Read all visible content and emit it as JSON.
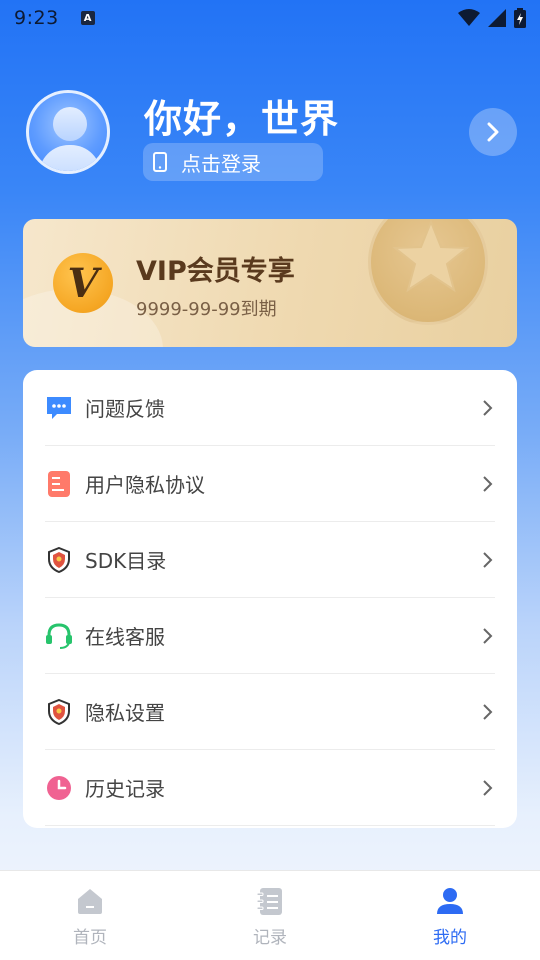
{
  "status_bar": {
    "time": "9:23",
    "notification_letter": "A"
  },
  "profile": {
    "greeting": "你好，世界",
    "login_label": "点击登录"
  },
  "vip": {
    "badge_letter": "V",
    "title": "VIP会员专享",
    "expire": "9999-99-99到期"
  },
  "menu": {
    "items": [
      {
        "label": "问题反馈",
        "icon": "chat-bubble-icon",
        "color": "#3d8bff"
      },
      {
        "label": "用户隐私协议",
        "icon": "document-icon",
        "color": "#ff6a5c"
      },
      {
        "label": "SDK目录",
        "icon": "shield-icon",
        "color": "#e0533f"
      },
      {
        "label": "在线客服",
        "icon": "headset-icon",
        "color": "#27c46c"
      },
      {
        "label": "隐私设置",
        "icon": "shield-icon",
        "color": "#e0533f"
      },
      {
        "label": "历史记录",
        "icon": "clock-icon",
        "color": "#f06292"
      }
    ]
  },
  "tab_bar": {
    "tabs": [
      {
        "label": "首页",
        "icon": "home-icon",
        "active": false
      },
      {
        "label": "记录",
        "icon": "notebook-icon",
        "active": false
      },
      {
        "label": "我的",
        "icon": "user-icon",
        "active": true
      }
    ]
  },
  "colors": {
    "accent": "#2d6bf3",
    "gradient_top": "#2273f5",
    "vip_text": "#5a3a1e",
    "tab_inactive": "#b0b4bc"
  }
}
